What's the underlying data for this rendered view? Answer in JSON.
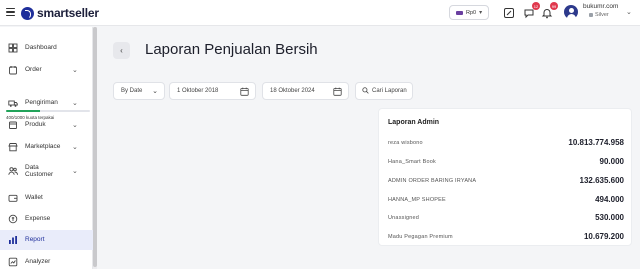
{
  "header": {
    "logo_text": "smartseller",
    "store_selector": "Rp0",
    "notifications": {
      "chat_badge": "12",
      "bell_badge": "99"
    },
    "user": {
      "email": "bukumr.com",
      "tier": "Silver"
    }
  },
  "sidebar": {
    "quota_text": "400/1000 kuota terpakai",
    "quota_fraction": 0.4,
    "items": [
      {
        "label": "Dashboard",
        "icon": "dashboard-icon"
      },
      {
        "label": "Order",
        "icon": "order-icon"
      },
      {
        "label": "Pengiriman",
        "icon": "truck-icon"
      },
      {
        "label": "Produk",
        "icon": "box-icon"
      },
      {
        "label": "Marketplace",
        "icon": "store-icon"
      },
      {
        "label": "Data Customer",
        "icon": "users-icon"
      },
      {
        "label": "Wallet",
        "icon": "wallet-icon"
      },
      {
        "label": "Expense",
        "icon": "expense-icon"
      },
      {
        "label": "Report",
        "icon": "chart-icon"
      },
      {
        "label": "Analyzer",
        "icon": "analyzer-icon"
      }
    ]
  },
  "main": {
    "page_title": "Laporan Penjualan Bersih",
    "filter_type": "By Date",
    "date_start": "1 Oktober 2018",
    "date_end": "18 Oktober 2024",
    "search_label": "Cari Laporan"
  },
  "report_card": {
    "title": "Laporan Admin",
    "rows": [
      {
        "name": "reza wisbono",
        "value": "10.813.774.958"
      },
      {
        "name": "Hana_Smart Book",
        "value": "90.000"
      },
      {
        "name": "ADMIN ORDER BARING IRYANA",
        "value": "132.635.600"
      },
      {
        "name": "HANNA_MP SHOPEE",
        "value": "494.000"
      },
      {
        "name": "Unassigned",
        "value": "530.000"
      },
      {
        "name": "Madu Pegagan Premium",
        "value": "10.679.200"
      }
    ]
  }
}
